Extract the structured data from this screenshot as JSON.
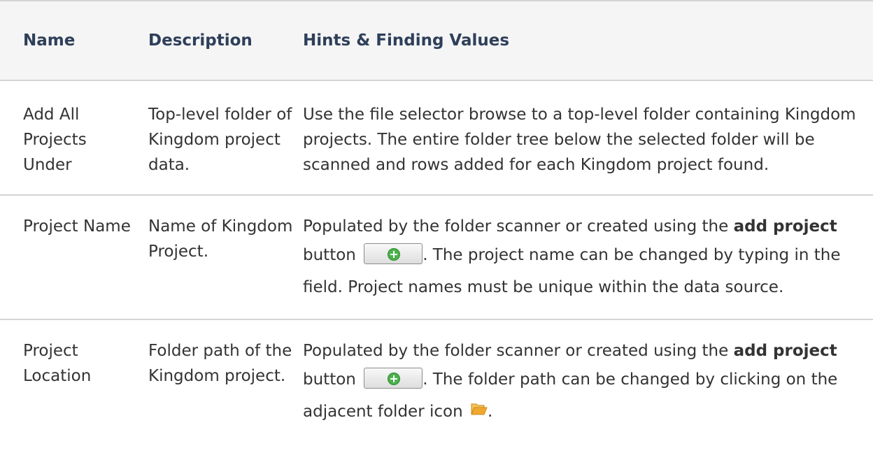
{
  "header": {
    "name": "Name",
    "description": "Description",
    "hints": "Hints & Finding Values"
  },
  "rows": [
    {
      "name": "Add All Projects Under",
      "description": "Top-level folder of Kingdom project data.",
      "hints": "Use the file selector browse to a top-level folder containing Kingdom projects. The entire folder tree below the selected folder will be scanned and rows added for each Kingdom project found."
    },
    {
      "name": "Project Name",
      "description": "Name of Kingdom Project.",
      "hints_pre": "Populated by the folder scanner or created using the ",
      "hints_bold": "add project",
      "hints_mid": " button ",
      "hints_post": ". The project name can be changed by typing in the field. Project names must be unique within the data source."
    },
    {
      "name": "Project Location",
      "description": "Folder path of the Kingdom project.",
      "hints_pre": "Populated by the folder scanner or created using the ",
      "hints_bold": "add project",
      "hints_mid": " button ",
      "hints_post": ". The folder path can be changed by clicking on the adjacent folder icon ",
      "hints_end": "."
    }
  ],
  "icons": {
    "add_button_icon": "plus-circle-icon",
    "folder_icon": "folder-open-icon"
  },
  "colors": {
    "header_text": "#2e3f5a",
    "header_bg": "#f5f5f5",
    "rule": "#d4d4d4",
    "add_icon_green": "#49b24a",
    "folder_orange": "#f0a830"
  }
}
